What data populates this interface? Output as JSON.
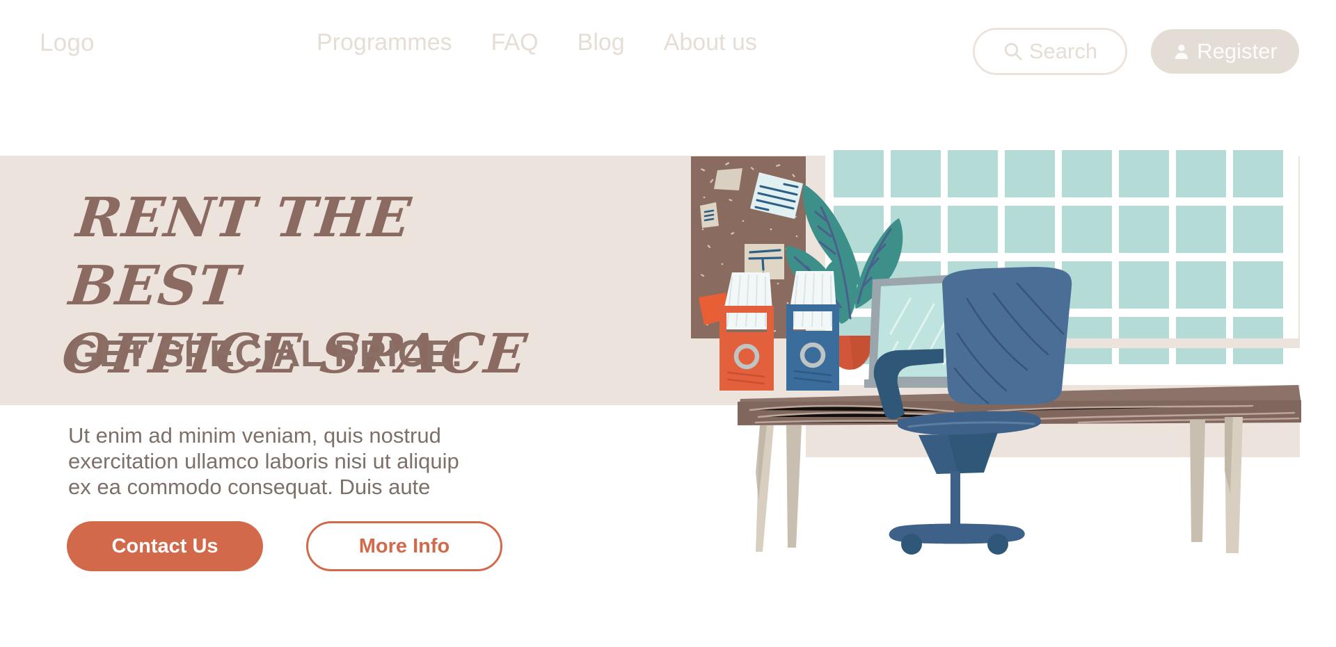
{
  "nav": {
    "logo": "Logo",
    "links": [
      {
        "label": "Programmes"
      },
      {
        "label": "FAQ"
      },
      {
        "label": "Blog"
      },
      {
        "label": "About us"
      }
    ],
    "search": {
      "placeholder": "Search",
      "icon": "search-icon"
    },
    "register": {
      "label": "Register",
      "icon": "user-icon"
    }
  },
  "hero": {
    "headline_line1": "Rent The Best",
    "headline_line2": "Office Space",
    "subline": "GET SPECIAL PRICE!",
    "paragraph": "Ut enim ad minim veniam, quis nostrud exercitation ullamco laboris nisi ut aliquip ex ea commodo consequat. Duis aute",
    "primary_button": "Contact Us",
    "secondary_button": "More Info"
  },
  "colors": {
    "band_bg": "#ece3dd",
    "headline": "#8a6a61",
    "subline": "#8a6f66",
    "body_text": "#7e7069",
    "accent_orange": "#d2694a",
    "nav_text": "#e6ddd5",
    "register_bg": "#e4ddd6",
    "corkboard": "#8a6b5f",
    "window_pane": "#b5dbd7",
    "chair_blue": "#4a6e96",
    "desk_brown": "#80675e",
    "leg_beige": "#cfc6b8",
    "plant_green": "#3d8f89",
    "page_bg": "#ffffff"
  },
  "illustration": {
    "scene": "office-workspace",
    "objects": [
      "corkboard-with-notes",
      "window-grid",
      "potted-plant",
      "orange-file-organizer",
      "blue-file-organizer",
      "laptop",
      "desk",
      "office-chair"
    ]
  }
}
